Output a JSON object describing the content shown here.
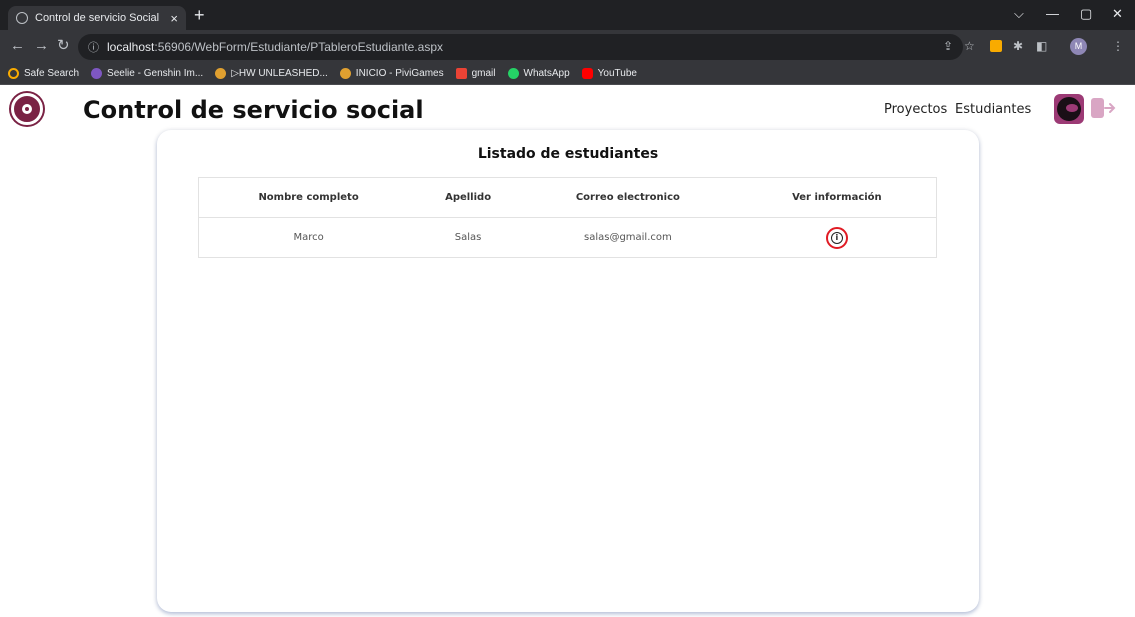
{
  "browser": {
    "tab_title": "Control de servicio Social",
    "tab_close": "×",
    "new_tab": "+",
    "url_host": "localhost",
    "url_rest": ":56906/WebForm/Estudiante/PTableroEstudiante.aspx",
    "avatar_letter": "M",
    "bookmarks": [
      {
        "label": "Safe Search",
        "icon": "safe-search-icon",
        "color": "#f9ab00"
      },
      {
        "label": "Seelie - Genshin Im...",
        "icon": "seelie-icon",
        "color": "#7e57c2"
      },
      {
        "label": "▷HW UNLEASHED...",
        "icon": "pivigames-icon",
        "color": "#e0a030"
      },
      {
        "label": "INICIO - PiviGames",
        "icon": "pivigames-icon",
        "color": "#e0a030"
      },
      {
        "label": "gmail",
        "icon": "gmail-icon",
        "color": "#ea4335"
      },
      {
        "label": "WhatsApp",
        "icon": "whatsapp-icon",
        "color": "#25d366"
      },
      {
        "label": "YouTube",
        "icon": "youtube-icon",
        "color": "#ff0000"
      }
    ]
  },
  "header": {
    "title": "Control de servicio social",
    "nav": [
      "Proyectos",
      "Estudiantes"
    ]
  },
  "main": {
    "title": "Listado de estudiantes",
    "columns": [
      "Nombre completo",
      "Apellido",
      "Correo electronico",
      "Ver información"
    ],
    "rows": [
      {
        "nombre": "Marco",
        "apellido": "Salas",
        "correo": "salas@gmail.com"
      }
    ]
  },
  "colors": {
    "brand": "#7a2244",
    "accent": "#9c3a75",
    "info_highlight": "#e01b24"
  }
}
